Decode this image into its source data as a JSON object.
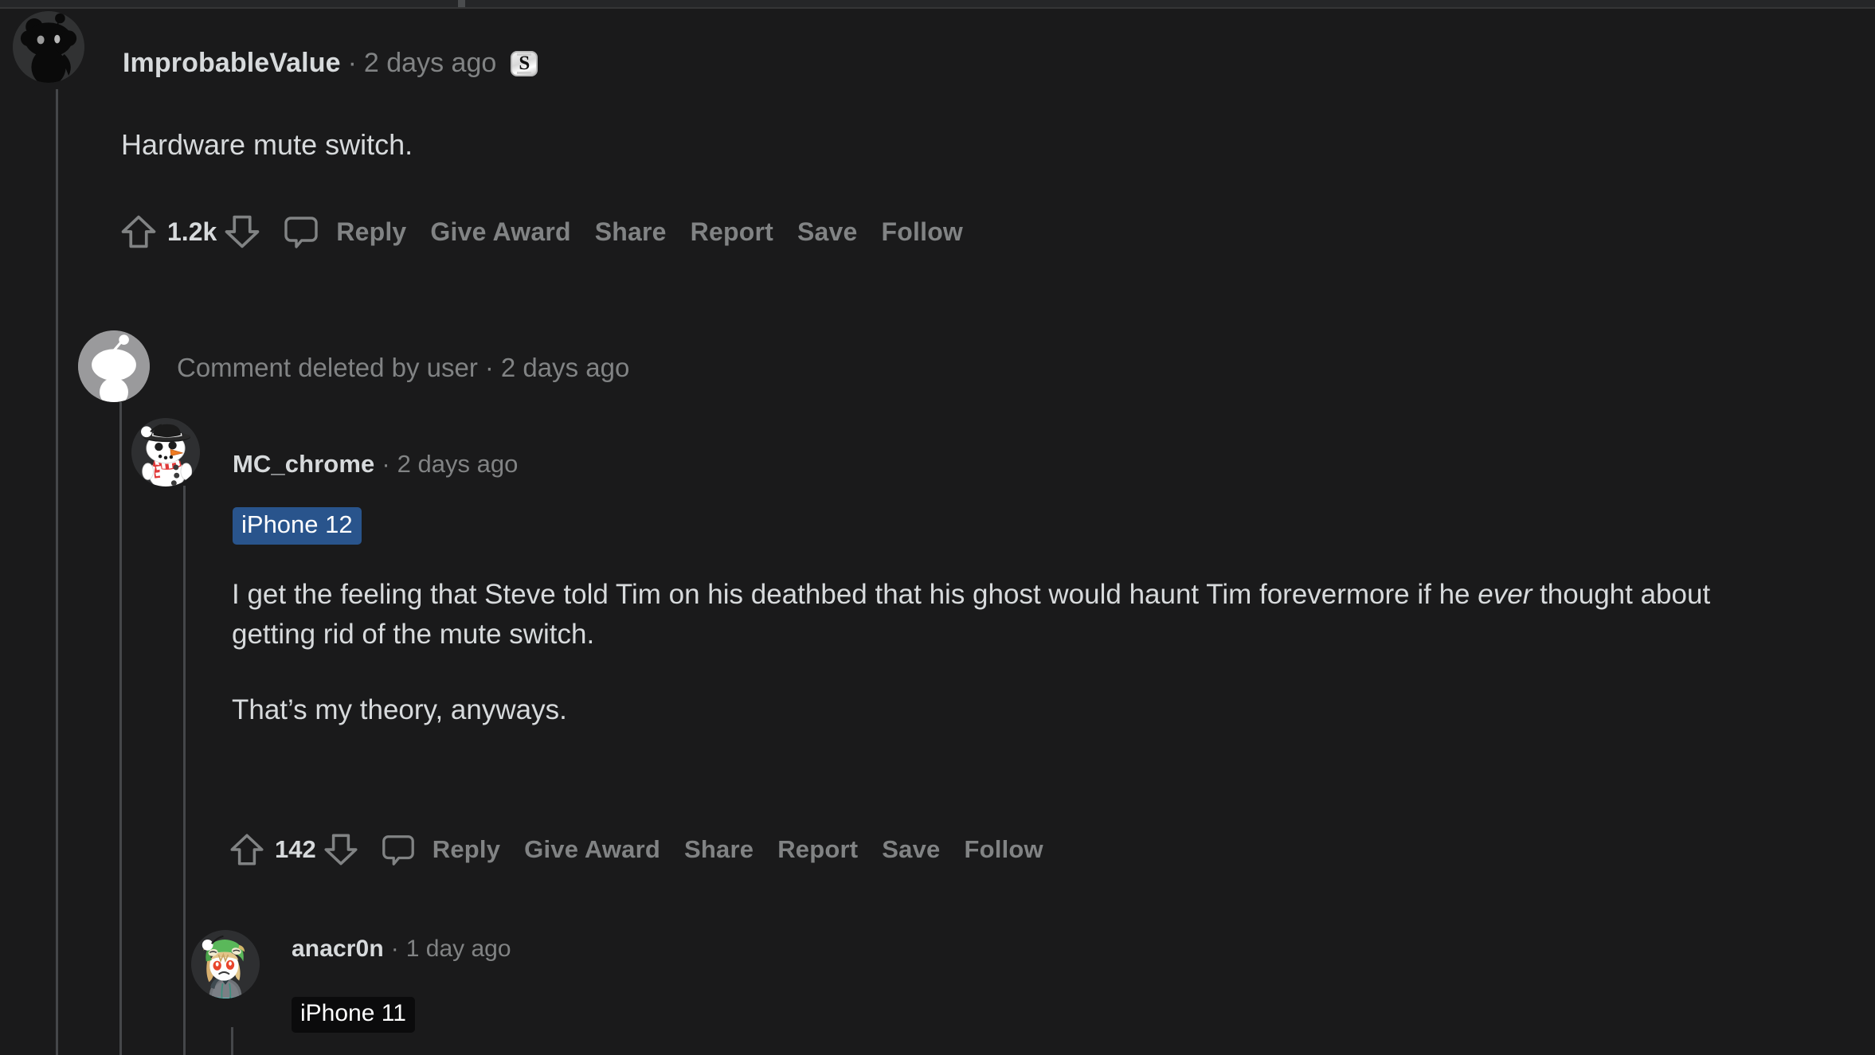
{
  "theme": {
    "background": "#1a1a1b",
    "text_primary": "#d7dadc",
    "text_muted": "#818384",
    "threadline": "#45474a",
    "flair_blue": "#29548c",
    "flair_black": "#0b0b0c",
    "award_silver": "#d8d8d8"
  },
  "comments": [
    {
      "id": "op",
      "author": "ImprobableValue",
      "separator": "·",
      "timestamp": "2 days ago",
      "award": {
        "letter": "S",
        "name": "silver-award"
      },
      "avatar": "snoo-black-silhouette",
      "body": "Hardware mute switch.",
      "score": "1.2k",
      "actions": [
        "Reply",
        "Give Award",
        "Share",
        "Report",
        "Save",
        "Follow"
      ]
    },
    {
      "id": "deleted",
      "text": "Comment deleted by user",
      "separator": "·",
      "timestamp": "2 days ago",
      "avatar": "snoo-default-grey"
    },
    {
      "id": "mc",
      "author": "MC_chrome",
      "separator": "·",
      "timestamp": "2 days ago",
      "flair": "iPhone 12",
      "avatar": "snowman-avatar",
      "paragraphs": [
        {
          "before": "I get the feeling that Steve told Tim on his deathbed that his ghost would haunt Tim forevermore if he ",
          "italic": "ever",
          "after": " thought about getting rid of the mute switch."
        },
        {
          "before": "That’s my theory, anyways.",
          "italic": "",
          "after": ""
        }
      ],
      "score": "142",
      "actions": [
        "Reply",
        "Give Award",
        "Share",
        "Report",
        "Save",
        "Follow"
      ]
    },
    {
      "id": "ana",
      "author": "anacr0n",
      "separator": "·",
      "timestamp": "1 day ago",
      "flair": "iPhone 11",
      "avatar": "frog-hood-avatar"
    }
  ],
  "icons": {
    "upvote": "upvote-arrow-icon",
    "downvote": "downvote-arrow-icon",
    "comment": "comment-bubble-icon"
  }
}
